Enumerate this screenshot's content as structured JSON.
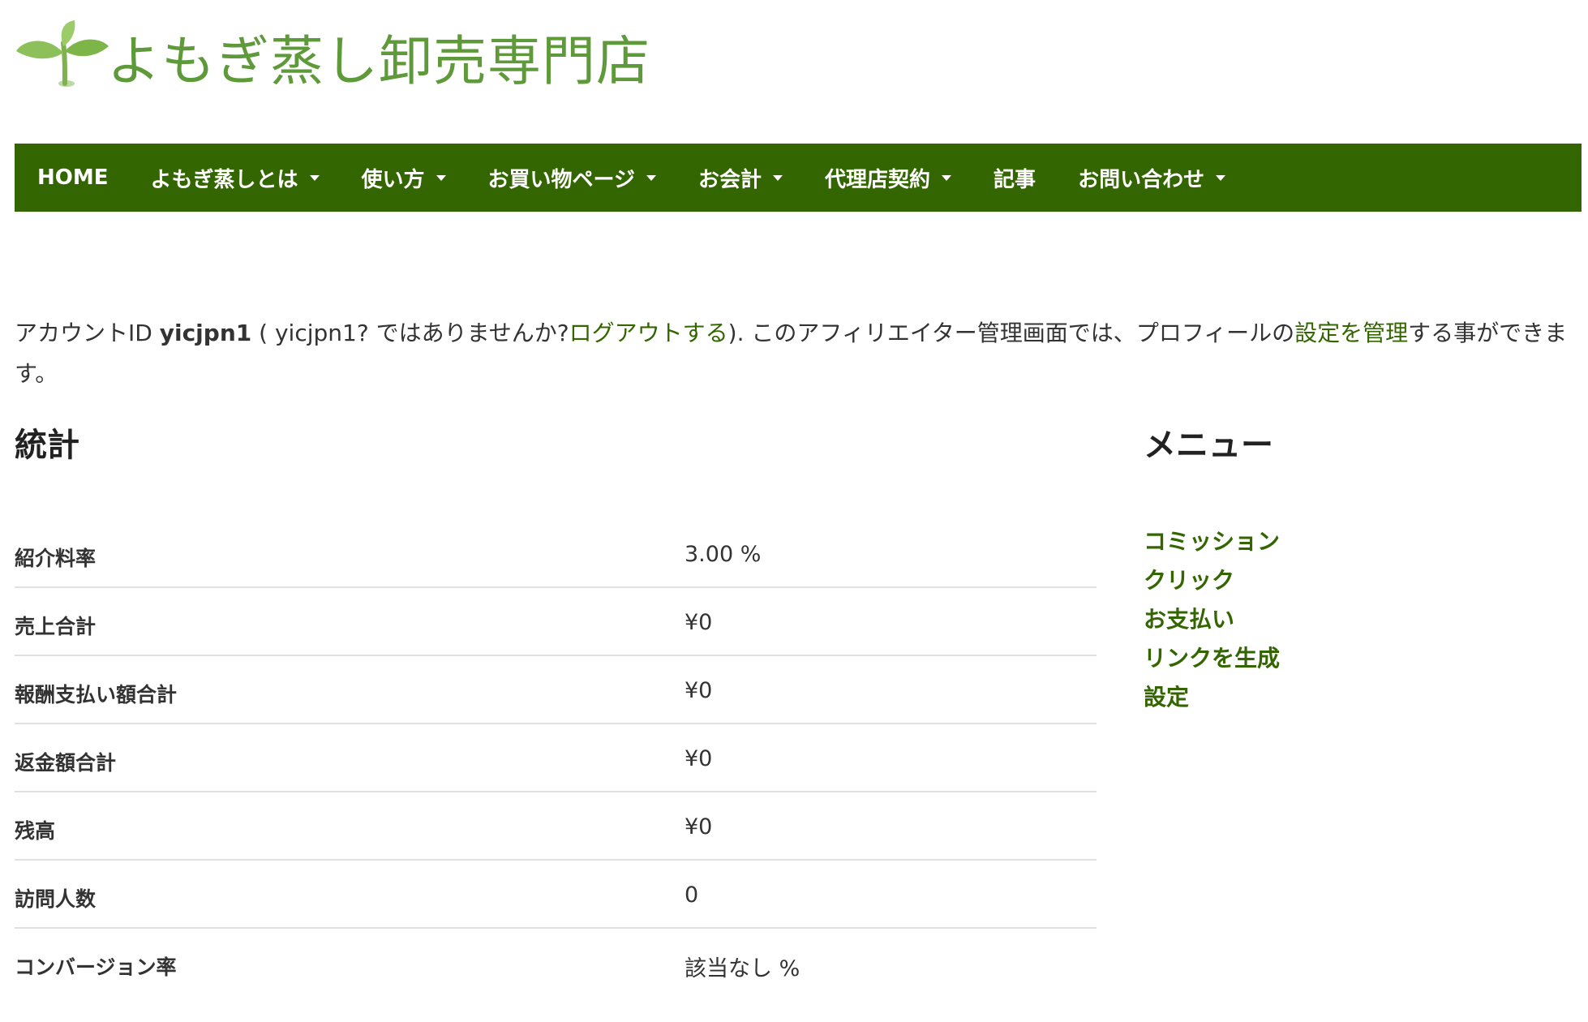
{
  "header": {
    "logo_text": "よもぎ蒸し卸売専門店",
    "logo_icon": "sprout-icon",
    "brand_color": "#5f9a3a"
  },
  "nav": {
    "background": "#336600",
    "items": [
      {
        "label": "HOME",
        "dropdown": false
      },
      {
        "label": "よもぎ蒸しとは",
        "dropdown": true
      },
      {
        "label": "使い方",
        "dropdown": true
      },
      {
        "label": "お買い物ページ",
        "dropdown": true
      },
      {
        "label": "お会計",
        "dropdown": true
      },
      {
        "label": "代理店契約",
        "dropdown": true
      },
      {
        "label": "記事",
        "dropdown": false
      },
      {
        "label": "お問い合わせ",
        "dropdown": true
      }
    ]
  },
  "intro": {
    "prefix": "アカウントID ",
    "account_id": "yicjpn1",
    "middle_open": " ( ",
    "account_id_repeat": "yicjpn1? ではありませんか?",
    "logout_link": "ログアウトする",
    "middle_text": "). このアフィリエイター管理画面では、プロフィールの",
    "settings_link": "設定を管理",
    "suffix": "する事ができます。"
  },
  "stats": {
    "title": "統計",
    "rows": [
      {
        "label": "紹介料率",
        "value": "3.00 %"
      },
      {
        "label": "売上合計",
        "value": "¥0"
      },
      {
        "label": "報酬支払い額合計",
        "value": "¥0"
      },
      {
        "label": "返金額合計",
        "value": "¥0"
      },
      {
        "label": "残高",
        "value": "¥0"
      },
      {
        "label": "訪問人数",
        "value": "0"
      },
      {
        "label": "コンバージョン率",
        "value": "該当なし %"
      }
    ]
  },
  "menu": {
    "title": "メニュー",
    "items": [
      {
        "label": "コミッション"
      },
      {
        "label": "クリック"
      },
      {
        "label": "お支払い"
      },
      {
        "label": "リンクを生成"
      },
      {
        "label": "設定"
      }
    ],
    "link_color": "#336600"
  }
}
